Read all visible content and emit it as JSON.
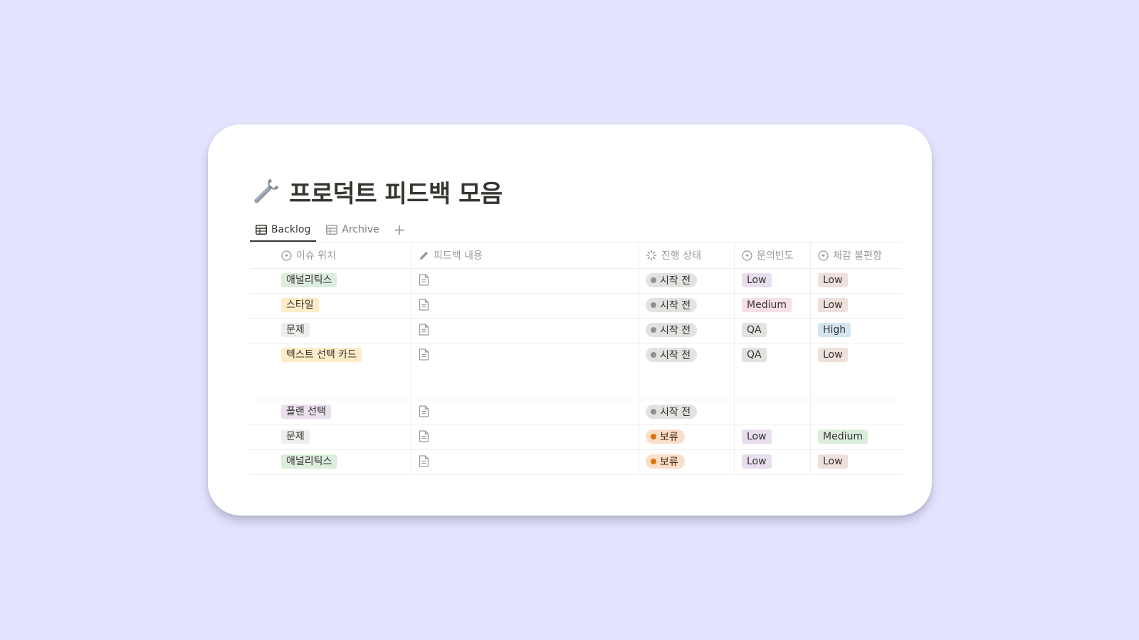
{
  "page": {
    "title": "프로덕트 피드백 모음",
    "title_icon": "wrench-icon"
  },
  "tabs": [
    {
      "label": "Backlog",
      "icon": "table-icon",
      "active": true
    },
    {
      "label": "Archive",
      "icon": "table-icon",
      "active": false
    }
  ],
  "add_tab_label": "+",
  "columns": [
    {
      "label": "이슈 위치",
      "icon": "select-icon"
    },
    {
      "label": "피드백 내용",
      "icon": "pencil-icon"
    },
    {
      "label": "진행 상태",
      "icon": "status-icon"
    },
    {
      "label": "문의빈도",
      "icon": "select-icon"
    },
    {
      "label": "체감 불편함",
      "icon": "select-icon"
    }
  ],
  "rows": [
    {
      "location": "애널리틱스",
      "location_color": "#dbeddb",
      "status": "시작 전",
      "frequency": "Low",
      "inconvenience": "Low"
    },
    {
      "location": "스타일",
      "location_color": "#fdecc8",
      "status": "시작 전",
      "frequency": "Medium",
      "inconvenience": "Low"
    },
    {
      "location": "문제",
      "location_color": "#eeeeed",
      "status": "시작 전",
      "frequency": "QA",
      "inconvenience": "High"
    },
    {
      "location": "텍스트 선택 카드",
      "location_color": "#fdecc8",
      "status": "시작 전",
      "frequency": "QA",
      "inconvenience": "Low"
    },
    {
      "location": "플랜 선택",
      "location_color": "#e8deee",
      "status": "시작 전",
      "frequency": "",
      "inconvenience": ""
    },
    {
      "location": "문제",
      "location_color": "#eeeeed",
      "status": "보류",
      "frequency": "Low",
      "inconvenience": "Medium"
    },
    {
      "location": "애널리틱스",
      "location_color": "#dbeddb",
      "status": "보류",
      "frequency": "Low",
      "inconvenience": "Low"
    }
  ],
  "colors": {
    "background": "#e4e3fd",
    "status_not_started_bg": "#e3e2e0",
    "status_not_started_dot": "#91918e",
    "status_hold_bg": "#fadec9",
    "status_hold_dot": "#d9730d",
    "tag_low": "#e8deee",
    "tag_medium": "#f5e0e9",
    "tag_qa": "#e3e2e0",
    "tag_low_inconvenience": "#eee0da",
    "tag_high": "#d3e5ef",
    "tag_medium_inconvenience": "#dbeddb"
  }
}
